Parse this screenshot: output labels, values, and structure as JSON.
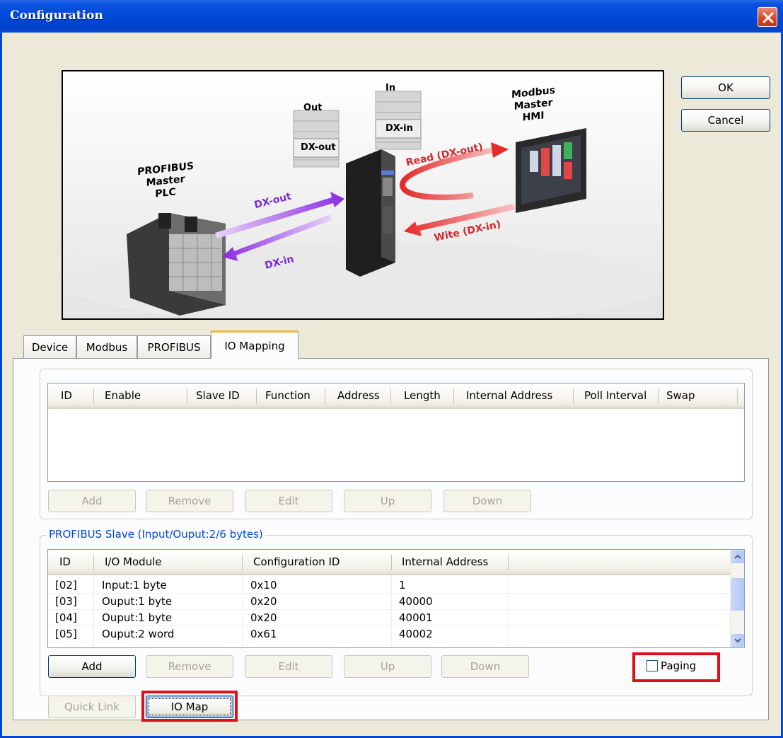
{
  "window": {
    "title": "Configuration",
    "close_icon": "close-icon"
  },
  "buttons": {
    "ok": "OK",
    "cancel": "Cancel"
  },
  "illustration": {
    "plc_label": [
      "PROFIBUS",
      "Master",
      "PLC"
    ],
    "hmi_label": [
      "Modbus",
      "Master",
      "HMI"
    ],
    "out_label": "Out",
    "in_label": "In",
    "dx_out_box": "DX-out",
    "dx_in_box": "DX-in",
    "arrow_dx_out": "DX-out",
    "arrow_dx_in": "DX-in",
    "arrow_read": "Read (DX-out)",
    "arrow_write": "Wite (DX-in)"
  },
  "tabs": [
    {
      "label": "Device"
    },
    {
      "label": "Modbus"
    },
    {
      "label": "PROFIBUS"
    },
    {
      "label": "IO Mapping",
      "active": true
    }
  ],
  "modbus_table": {
    "columns": [
      "ID",
      "Enable",
      "Slave ID",
      "Function",
      "Address",
      "Length",
      "Internal Address",
      "Poll Interval",
      "Swap"
    ],
    "rows": [],
    "buttons": {
      "add": "Add",
      "remove": "Remove",
      "edit": "Edit",
      "up": "Up",
      "down": "Down"
    }
  },
  "profibus_group": {
    "title": "PROFIBUS Slave (Input/Ouput:2/6 bytes)",
    "columns": [
      "ID",
      "I/O Module",
      "Configuration ID",
      "Internal Address"
    ],
    "rows": [
      {
        "id": "[02]",
        "module": "Input:1 byte",
        "config_id": "0x10",
        "address": "1"
      },
      {
        "id": "[03]",
        "module": "Ouput:1 byte",
        "config_id": "0x20",
        "address": "40000"
      },
      {
        "id": "[04]",
        "module": "Ouput:1 byte",
        "config_id": "0x20",
        "address": "40001"
      },
      {
        "id": "[05]",
        "module": "Ouput:2 word",
        "config_id": "0x61",
        "address": "40002"
      }
    ],
    "buttons": {
      "add": "Add",
      "remove": "Remove",
      "edit": "Edit",
      "up": "Up",
      "down": "Down"
    },
    "paging_label": "Paging",
    "paging_checked": false
  },
  "bottom_buttons": {
    "quick_link": "Quick Link",
    "io_map": "IO Map"
  },
  "colors": {
    "title_bar": "#0047d6",
    "highlight_frame": "#e0101a",
    "group_title": "#0046d5",
    "tab_accent": "#f4b63c"
  }
}
